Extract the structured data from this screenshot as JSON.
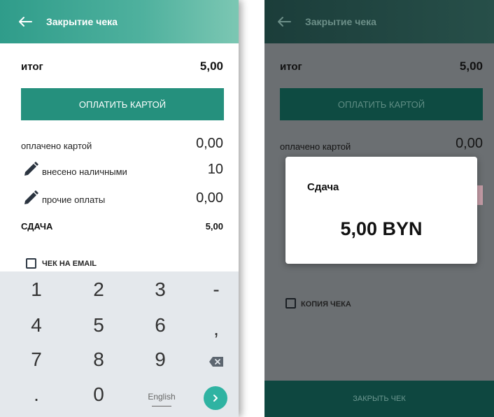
{
  "app": {
    "title": "Закрытие чека"
  },
  "summary": {
    "total_label": "итог",
    "total_value": "5,00",
    "pay_card_label": "ОПЛАТИТЬ КАРТОЙ",
    "rows": [
      {
        "label": "оплачено картой",
        "value": "0,00"
      },
      {
        "label": "внесено наличными",
        "value": "10"
      },
      {
        "label": "прочие оплаты",
        "value": "0,00"
      }
    ],
    "change_label": "СДАЧА",
    "change_value": "5,00",
    "receipt_email_label": "ЧЕК НА EMAIL",
    "receipt_copy_label": "КОПИЯ ЧЕКА",
    "close_receipt_label": "ЗАКРЫТЬ ЧЕК"
  },
  "keyboard": {
    "row1": [
      "1",
      "2",
      "3",
      "-"
    ],
    "row2": [
      "4",
      "5",
      "6",
      ","
    ],
    "row3": [
      "7",
      "8",
      "9"
    ],
    "row4": [
      ".",
      "0",
      "English"
    ]
  },
  "dialog": {
    "title": "Сдача",
    "amount": "5,00 BYN"
  },
  "colors": {
    "accent": "#25907d",
    "keyboard_bg": "#e4e8ec",
    "enter_key": "#2fb3a2",
    "overlay": "#6b6f72"
  }
}
